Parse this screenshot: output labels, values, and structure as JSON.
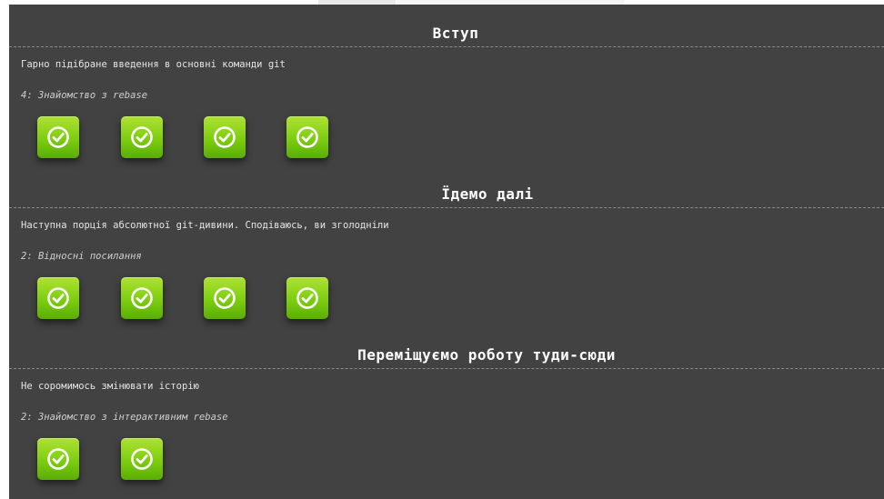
{
  "sections": [
    {
      "title": "Вступ",
      "description": "Гарно підібране введення в основні команди git",
      "lesson": "4: Знайомство з rebase",
      "levels": [
        {
          "status": "completed",
          "icon": "checkmark-icon"
        },
        {
          "status": "completed",
          "icon": "checkmark-icon"
        },
        {
          "status": "completed",
          "icon": "checkmark-icon"
        },
        {
          "status": "completed",
          "icon": "checkmark-icon"
        }
      ]
    },
    {
      "title": "Їдемо далі",
      "description": "Наступна порція абсолютної git-дивини. Сподіваюсь, ви зголодніли",
      "lesson": "2: Відносні посилання",
      "levels": [
        {
          "status": "completed",
          "icon": "checkmark-icon"
        },
        {
          "status": "completed",
          "icon": "checkmark-icon"
        },
        {
          "status": "completed",
          "icon": "checkmark-icon"
        },
        {
          "status": "completed",
          "icon": "checkmark-icon"
        }
      ]
    },
    {
      "title": "Переміщуємо роботу туди-сюди",
      "description": "Не соромимось змінювати історію",
      "lesson": "2: Знайомство з інтерактивним rebase",
      "levels": [
        {
          "status": "completed",
          "icon": "checkmark-icon"
        },
        {
          "status": "completed",
          "icon": "checkmark-icon"
        }
      ]
    }
  ],
  "colors": {
    "background": "#424242",
    "level_completed": "#7dcd0f",
    "heading_text": "#ffffff"
  }
}
